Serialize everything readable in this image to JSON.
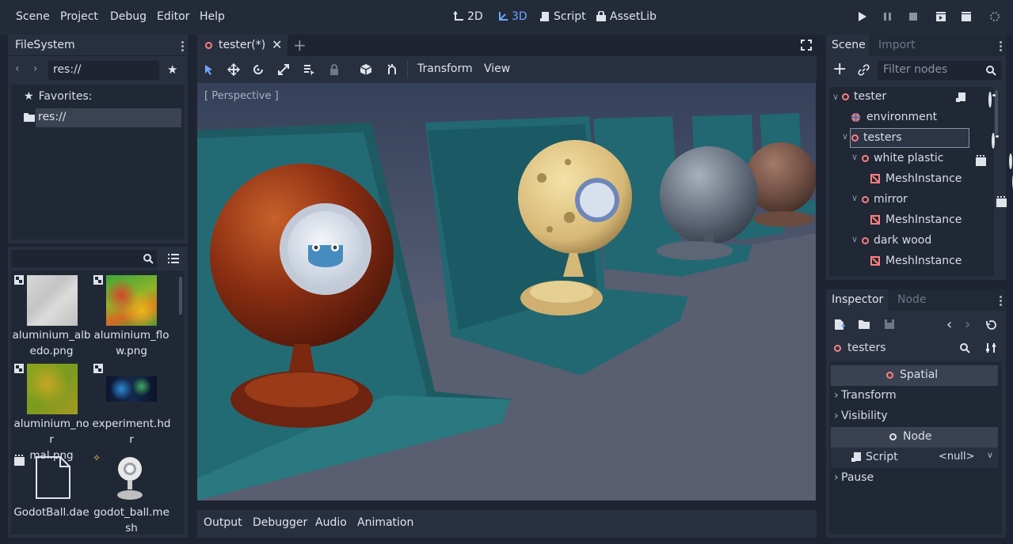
{
  "menubar": {
    "menus": [
      "Scene",
      "Project",
      "Debug",
      "Editor",
      "Help"
    ],
    "modes": [
      "2D",
      "3D",
      "Script",
      "AssetLib"
    ],
    "active_mode": "3D"
  },
  "filesystem": {
    "tab_label": "FileSystem",
    "path": "res://",
    "favorites_label": "Favorites:",
    "root_label": "res://",
    "files": [
      {
        "name": "aluminium_albedo.png",
        "line1": "aluminium_alb",
        "line2": "edo.png"
      },
      {
        "name": "aluminium_flow.png",
        "line1": "aluminium_flo",
        "line2": "w.png"
      },
      {
        "name": "aluminium_normal.png",
        "line1": "aluminium_nor",
        "line2": "mal.png"
      },
      {
        "name": "experiment.hdr",
        "line1": "experiment.hd",
        "line2": "r"
      },
      {
        "name": "GodotBall.dae",
        "line1": "GodotBall.dae",
        "line2": ""
      },
      {
        "name": "godot_ball.mesh",
        "line1": "godot_ball.me",
        "line2": "sh"
      }
    ]
  },
  "editor": {
    "scene_tab": "tester(*)",
    "toolbar_menus": [
      "Transform",
      "View"
    ],
    "viewport_label": "[ Perspective ]"
  },
  "bottom_tabs": [
    "Output",
    "Debugger",
    "Audio",
    "Animation"
  ],
  "scene_dock": {
    "tabs": [
      "Scene",
      "Import"
    ],
    "filter_placeholder": "Filter nodes",
    "tree": [
      {
        "label": "tester",
        "depth": 0,
        "type": "spatial"
      },
      {
        "label": "environment",
        "depth": 1,
        "type": "environment"
      },
      {
        "label": "testers",
        "depth": 1,
        "type": "spatial"
      },
      {
        "label": "white plastic",
        "depth": 2,
        "type": "spatial"
      },
      {
        "label": "MeshInstance",
        "depth": 3,
        "type": "mesh"
      },
      {
        "label": "mirror",
        "depth": 2,
        "type": "spatial"
      },
      {
        "label": "MeshInstance",
        "depth": 3,
        "type": "mesh"
      },
      {
        "label": "dark wood",
        "depth": 2,
        "type": "spatial"
      },
      {
        "label": "MeshInstance",
        "depth": 3,
        "type": "mesh"
      }
    ]
  },
  "inspector": {
    "tabs": [
      "Inspector",
      "Node"
    ],
    "object_name": "testers",
    "sections": {
      "spatial": "Spatial",
      "transform": "Transform",
      "visibility": "Visibility",
      "node": "Node",
      "script_label": "Script",
      "script_value": "<null>",
      "pause": "Pause"
    }
  },
  "colors": {
    "accent": "#6ea7ff",
    "node_red": "#fc7f7f",
    "panel": "#283040",
    "background": "#1e2431"
  }
}
